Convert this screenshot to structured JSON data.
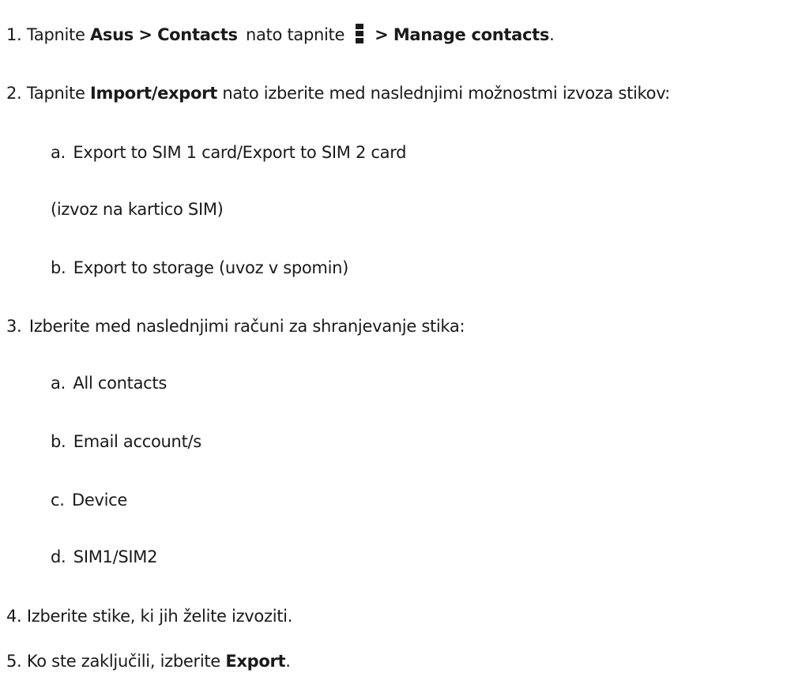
{
  "steps": {
    "s1": {
      "number": "1.",
      "prefix": "Tapnite",
      "asus": "Asus",
      "sep1": ">",
      "contacts": "Contacts",
      "mid": "nato tapnite",
      "icon": "more-vertical-menu-icon",
      "sep2": ">",
      "manage": "Manage contacts",
      "end": "."
    },
    "s2": {
      "number": "2.",
      "prefix": "Tapnite",
      "import_export": "Import/export",
      "rest": "nato izberite med naslednjimi možnostmi izvoza stikov:",
      "options": [
        {
          "letter": "a.",
          "text": "Export to SIM 1 card/Export to SIM 2 card"
        },
        {
          "letter": "b.",
          "text": "Export to storage (uvoz v spomin)"
        }
      ],
      "note": "(izvoz na kartico SIM)"
    },
    "s3": {
      "number": "3.",
      "text": "Izberite med naslednjimi računi za shranjevanje stika:",
      "options": [
        {
          "letter": "a.",
          "text": "All contacts"
        },
        {
          "letter": "b.",
          "text": "Email account/s"
        },
        {
          "letter": "c.",
          "text": "Device"
        },
        {
          "letter": "d.",
          "text": "SIM1/SIM2"
        }
      ]
    },
    "s4": {
      "number": "4.",
      "text": "Izberite stike, ki jih želite izvoziti."
    },
    "s5": {
      "number": "5.",
      "prefix": "Ko ste zaključili, izberite",
      "export": "Export",
      "end": "."
    }
  }
}
